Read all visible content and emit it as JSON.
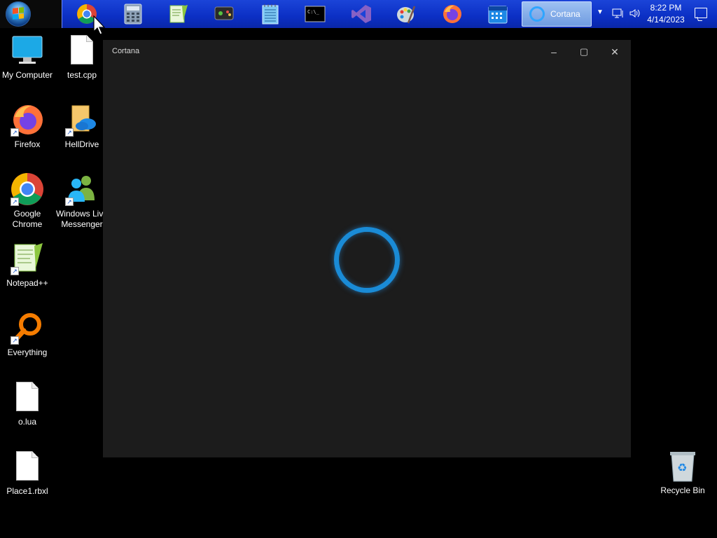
{
  "taskbar": {
    "pinned": [
      "chrome-icon",
      "calculator-icon",
      "notepadpp-icon",
      "game-controller-icon",
      "notepad-icon",
      "cmd-icon",
      "visual-studio-icon",
      "paint-icon",
      "firefox-icon",
      "calendar-icon"
    ],
    "active_task_label": "Cortana",
    "time": "8:22 PM",
    "date": "4/14/2023"
  },
  "desktop": {
    "icons": [
      {
        "label": "My Computer"
      },
      {
        "label": "test.cpp"
      },
      {
        "label": "Firefox"
      },
      {
        "label": "HellDrive"
      },
      {
        "label": "Google Chrome"
      },
      {
        "label": "Windows Live Messenger"
      },
      {
        "label": "Notepad++"
      },
      {
        "label": "Everything"
      },
      {
        "label": "o.lua"
      },
      {
        "label": "Place1.rbxl"
      },
      {
        "label": "Recycle Bin"
      }
    ]
  },
  "window": {
    "title": "Cortana",
    "minimize": "–",
    "maximize": "▢",
    "close": "✕"
  },
  "colors": {
    "taskbar_band": "#0b2fc4",
    "window_bg": "#1c1c1c",
    "cortana_ring": "#1a8bd6"
  }
}
